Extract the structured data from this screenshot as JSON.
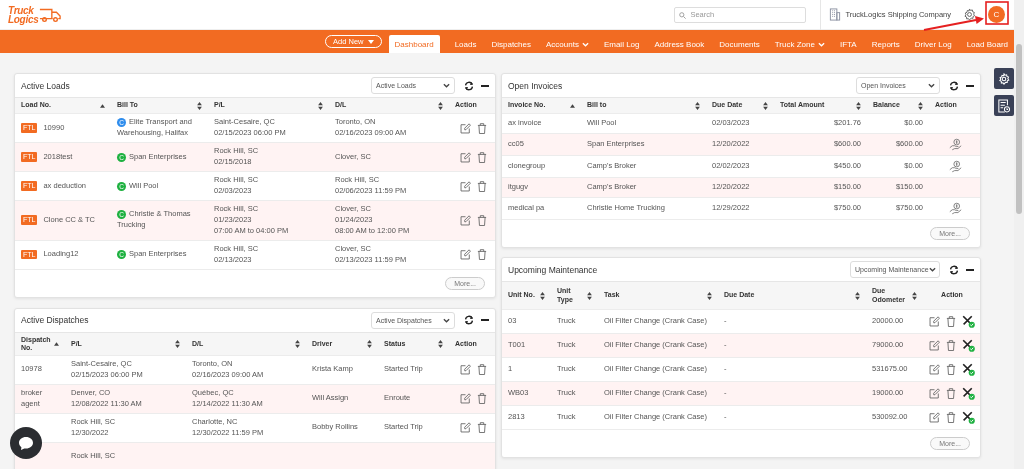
{
  "header": {
    "logo": [
      "Truck",
      "Logics"
    ],
    "search": {
      "placeholder": "Search"
    },
    "company": "TruckLogics Shipping Company",
    "avatar": "C"
  },
  "nav": {
    "add_new": "Add New",
    "items": [
      {
        "label": "Dashboard",
        "selected": true,
        "dropdown": false
      },
      {
        "label": "Loads",
        "selected": false,
        "dropdown": false
      },
      {
        "label": "Dispatches",
        "selected": false,
        "dropdown": false
      },
      {
        "label": "Accounts",
        "selected": false,
        "dropdown": true
      },
      {
        "label": "Email Log",
        "selected": false,
        "dropdown": false
      },
      {
        "label": "Address Book",
        "selected": false,
        "dropdown": false
      },
      {
        "label": "Documents",
        "selected": false,
        "dropdown": false
      },
      {
        "label": "Truck Zone",
        "selected": false,
        "dropdown": true
      },
      {
        "label": "IFTA",
        "selected": false,
        "dropdown": false
      },
      {
        "label": "Reports",
        "selected": false,
        "dropdown": false
      },
      {
        "label": "Driver Log",
        "selected": false,
        "dropdown": false
      },
      {
        "label": "Load Board",
        "selected": false,
        "dropdown": false
      }
    ]
  },
  "active_loads": {
    "title": "Active Loads",
    "filter": "Active Loads",
    "more": "More...",
    "columns": [
      {
        "label": "Load No.",
        "sortable": true,
        "sorted": true
      },
      {
        "label": "Bill To",
        "sortable": true,
        "sorted": false
      },
      {
        "label": "P/L",
        "sortable": true,
        "sorted": false
      },
      {
        "label": "D/L",
        "sortable": true,
        "sorted": false
      },
      {
        "label": "Action",
        "sortable": false
      }
    ],
    "rows": [
      {
        "tag": "FTL",
        "load_no": "10990",
        "bill_to": {
          "badge": "C",
          "color": "#2f8ded",
          "name": "Elite Transport and Warehousing, Halifax"
        },
        "pl": [
          "Saint-Cesaire, QC",
          "02/15/2023 06:00 PM"
        ],
        "dl": [
          "Toronto, ON",
          "02/16/2023 09:00 AM"
        ]
      },
      {
        "tag": "FTL",
        "load_no": "2018test",
        "bill_to": {
          "badge": "C",
          "color": "#1fb141",
          "name": "Span Enterprises"
        },
        "pl": [
          "Rock Hill, SC",
          "02/15/2018"
        ],
        "dl": [
          "Clover, SC"
        ]
      },
      {
        "tag": "FTL",
        "load_no": "ax deduction",
        "bill_to": {
          "badge": "C",
          "color": "#1fb141",
          "name": "Will Pool"
        },
        "pl": [
          "Rock Hill, SC",
          "02/03/2023"
        ],
        "dl": [
          "Rock Hill, SC",
          "02/06/2023 11:59 PM"
        ]
      },
      {
        "tag": "FTL",
        "load_no": "Clone CC & TC",
        "bill_to": {
          "badge": "C",
          "color": "#1fb141",
          "name": "Christie & Thomas Trucking"
        },
        "pl": [
          "Rock Hill, SC",
          "01/23/2023",
          "07:00 AM to 04:00 PM"
        ],
        "dl": [
          "Clover, SC",
          "01/24/2023",
          "08:00 AM to 12:00 PM"
        ]
      },
      {
        "tag": "FTL",
        "load_no": "Loading12",
        "bill_to": {
          "badge": "C",
          "color": "#1fb141",
          "name": "Span Enterprises"
        },
        "pl": [
          "Rock Hill, SC",
          "02/13/2023"
        ],
        "dl": [
          "Clover, SC",
          "02/13/2023 11:59 PM"
        ]
      }
    ]
  },
  "active_dispatches": {
    "title": "Active Dispatches",
    "filter": "Active Dispatches",
    "columns": [
      {
        "label": "Dispatch No.",
        "sortable": true,
        "sorted": true
      },
      {
        "label": "P/L",
        "sortable": true,
        "sorted": false
      },
      {
        "label": "D/L",
        "sortable": true,
        "sorted": false
      },
      {
        "label": "Driver",
        "sortable": true,
        "sorted": false
      },
      {
        "label": "Status",
        "sortable": true,
        "sorted": false
      },
      {
        "label": "Action",
        "sortable": false
      }
    ],
    "rows": [
      {
        "dispatch_no": "10978",
        "pl": [
          "Saint-Cesaire, QC",
          "02/15/2023 06:00 PM"
        ],
        "dl": [
          "Toronto, ON",
          "02/16/2023 09:00 AM"
        ],
        "driver": "Krista Kamp",
        "status": "Started Trip"
      },
      {
        "dispatch_no": "broker agent",
        "pl": [
          "Denver, CO",
          "12/08/2022 11:30 AM"
        ],
        "dl": [
          "Québec, QC",
          "12/14/2022 11:30 AM"
        ],
        "driver": "Will Assign",
        "status": "Enroute"
      },
      {
        "pl": [
          "Rock Hill, SC",
          "12/30/2022"
        ],
        "dl": [
          "Charlotte, NC",
          "12/30/2022 11:59 PM"
        ],
        "driver": "Bobby Rollins",
        "status": "Started Trip"
      },
      {
        "pl": [
          "Rock Hill, SC"
        ]
      }
    ]
  },
  "open_invoices": {
    "title": "Open Invoices",
    "filter": "Open Invoices",
    "more": "More...",
    "columns": [
      {
        "label": "Invoice No.",
        "sortable": true,
        "sorted": true
      },
      {
        "label": "Bill to",
        "sortable": true,
        "sorted": false
      },
      {
        "label": "Due Date",
        "sortable": true,
        "sorted": false
      },
      {
        "label": "Total Amount",
        "sortable": true,
        "sorted": false
      },
      {
        "label": "Balance",
        "sortable": true,
        "sorted": false
      },
      {
        "label": "Action",
        "sortable": false
      }
    ],
    "rows": [
      {
        "invoice_no": "ax invoice",
        "bill_to": "Will Pool",
        "due_date": "02/03/2023",
        "total": "$201.76",
        "balance": "$0.00",
        "payment_action": false
      },
      {
        "invoice_no": "cc05",
        "bill_to": "Span Enterprises",
        "due_date": "12/20/2022",
        "total": "$600.00",
        "balance": "$600.00",
        "payment_action": true
      },
      {
        "invoice_no": "clonegroup",
        "bill_to": "Camp's Broker",
        "due_date": "02/02/2023",
        "total": "$450.00",
        "balance": "$0.00",
        "payment_action": true
      },
      {
        "invoice_no": "itgugv",
        "bill_to": "Camp's Broker",
        "due_date": "12/20/2022",
        "total": "$150.00",
        "balance": "$150.00",
        "payment_action": false
      },
      {
        "invoice_no": "medical pa",
        "bill_to": "Christie Home Trucking",
        "due_date": "12/29/2022",
        "total": "$750.00",
        "balance": "$750.00",
        "payment_action": true
      }
    ]
  },
  "upcoming_maintenance": {
    "title": "Upcoming Maintenance",
    "filter": "Upcoming Maintenance",
    "more": "More...",
    "columns": [
      {
        "label": "Unit No.",
        "sortable": true,
        "sorted": false
      },
      {
        "label": "Unit Type",
        "sortable": true,
        "sorted": false
      },
      {
        "label": "Task",
        "sortable": true,
        "sorted": false
      },
      {
        "label": "Due Date",
        "sortable": true,
        "sorted": false
      },
      {
        "label": "Due Odometer",
        "sortable": true,
        "sorted": false
      },
      {
        "label": "Action",
        "sortable": false
      }
    ],
    "rows": [
      {
        "unit_no": "03",
        "unit_type": "Truck",
        "task": "Oil Filter Change (Crank Case)",
        "due_date": "-",
        "due_odometer": "20000.00"
      },
      {
        "unit_no": "T001",
        "unit_type": "Truck",
        "task": "Oil Filter Change (Crank Case)",
        "due_date": "-",
        "due_odometer": "79000.00"
      },
      {
        "unit_no": "1",
        "unit_type": "Truck",
        "task": "Oil Filter Change (Crank Case)",
        "due_date": "-",
        "due_odometer": "531675.00"
      },
      {
        "unit_no": "WB03",
        "unit_type": "Truck",
        "task": "Oil Filter Change (Crank Case)",
        "due_date": "-",
        "due_odometer": "19000.00"
      },
      {
        "unit_no": "2813",
        "unit_type": "Truck",
        "task": "Oil Filter Change (Crank Case)",
        "due_date": "-",
        "due_odometer": "530092.00"
      }
    ]
  }
}
